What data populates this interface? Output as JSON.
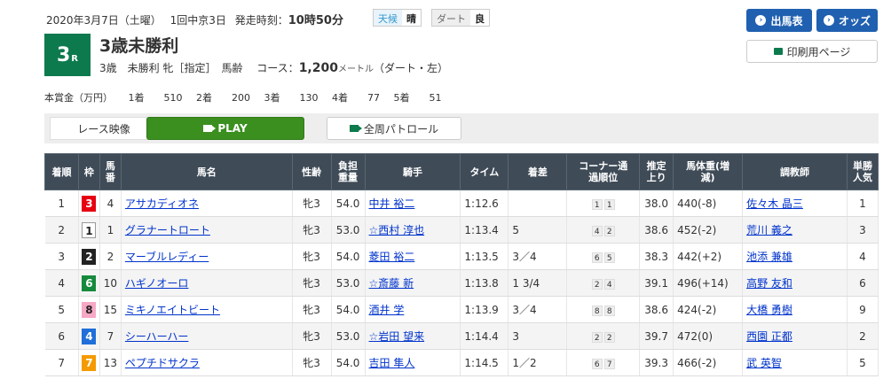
{
  "header": {
    "date": "2020年3月7日（土曜）",
    "meeting": "1回中京3日",
    "post_time_label": "発走時刻：",
    "post_time": "10時50分",
    "weather_label": "天候",
    "weather": "晴",
    "track_label": "ダート",
    "track_cond": "良"
  },
  "race": {
    "number": "3",
    "number_suffix": "R",
    "name": "3歳未勝利",
    "conditions": "3歳　未勝利 牝［指定］　馬齢　",
    "course_label": "コース：",
    "distance": "1,200",
    "distance_unit": "メートル",
    "surface": "（ダート・左）"
  },
  "buttons": {
    "entries": "出馬表",
    "odds": "オッズ",
    "print": "印刷用ページ"
  },
  "prize": {
    "label": "本賞金（万円）",
    "items": [
      {
        "place": "1着",
        "amount": "510"
      },
      {
        "place": "2着",
        "amount": "200"
      },
      {
        "place": "3着",
        "amount": "130"
      },
      {
        "place": "4着",
        "amount": "77"
      },
      {
        "place": "5着",
        "amount": "51"
      }
    ]
  },
  "video": {
    "label": "レース映像",
    "play": "PLAY",
    "patrol": "全周パトロール"
  },
  "table": {
    "headers": [
      "着順",
      "枠",
      "馬番",
      "馬名",
      "性齢",
      "負担重量",
      "騎手",
      "タイム",
      "着差",
      "コーナー通過順位",
      "推定上り",
      "馬体重(増減)",
      "調教師",
      "単勝人気"
    ],
    "rows": [
      {
        "rank": "1",
        "waku": "3",
        "num": "4",
        "horse": "アサカディオネ",
        "sex": "牝3",
        "weight": "54.0",
        "jockey": "中井 裕二",
        "time": "1:12.6",
        "margin": "",
        "c1": "1",
        "c2": "1",
        "last": "38.0",
        "bw": "440",
        "bwd": "(-8)",
        "trainer": "佐々木 晶三",
        "pop": "1"
      },
      {
        "rank": "2",
        "waku": "1",
        "num": "1",
        "horse": "グラナートロート",
        "sex": "牝3",
        "weight": "53.0",
        "jockey": "☆西村 淳也",
        "time": "1:13.4",
        "margin": "5",
        "c1": "4",
        "c2": "2",
        "last": "38.6",
        "bw": "452",
        "bwd": "(-2)",
        "trainer": "荒川 義之",
        "pop": "3"
      },
      {
        "rank": "3",
        "waku": "2",
        "num": "2",
        "horse": "マーブルレディー",
        "sex": "牝3",
        "weight": "54.0",
        "jockey": "菱田 裕二",
        "time": "1:13.5",
        "margin": "3／4",
        "c1": "6",
        "c2": "5",
        "last": "38.3",
        "bw": "442",
        "bwd": "(+2)",
        "trainer": "池添 兼雄",
        "pop": "4"
      },
      {
        "rank": "4",
        "waku": "6",
        "num": "10",
        "horse": "ハギノオーロ",
        "sex": "牝3",
        "weight": "53.0",
        "jockey": "☆斎藤 新",
        "time": "1:13.8",
        "margin": "1 3/4",
        "c1": "2",
        "c2": "4",
        "last": "39.1",
        "bw": "496",
        "bwd": "(+14)",
        "trainer": "高野 友和",
        "pop": "6"
      },
      {
        "rank": "5",
        "waku": "8",
        "num": "15",
        "horse": "ミキノエイトビート",
        "sex": "牝3",
        "weight": "54.0",
        "jockey": "酒井 学",
        "time": "1:13.9",
        "margin": "3／4",
        "c1": "8",
        "c2": "8",
        "last": "38.6",
        "bw": "424",
        "bwd": "(-2)",
        "trainer": "大橋 勇樹",
        "pop": "9"
      },
      {
        "rank": "6",
        "waku": "4",
        "num": "7",
        "horse": "シーハーハー",
        "sex": "牝3",
        "weight": "53.0",
        "jockey": "☆岩田 望来",
        "time": "1:14.4",
        "margin": "3",
        "c1": "2",
        "c2": "2",
        "last": "39.7",
        "bw": "472",
        "bwd": "(0)",
        "trainer": "西園 正都",
        "pop": "2"
      },
      {
        "rank": "7",
        "waku": "7",
        "num": "13",
        "horse": "ペプチドサクラ",
        "sex": "牝3",
        "weight": "54.0",
        "jockey": "吉田 隼人",
        "time": "1:14.5",
        "margin": "1／2",
        "c1": "6",
        "c2": "7",
        "last": "39.3",
        "bw": "466",
        "bwd": "(-2)",
        "trainer": "武 英智",
        "pop": "5"
      }
    ]
  },
  "colors": {
    "waku1": "#ffffff",
    "waku2": "#222222",
    "waku3": "#e60012",
    "waku4": "#1e6fd9",
    "waku5": "#f5d500",
    "waku6": "#168a3c",
    "waku7": "#f59a00",
    "waku8": "#f7a8c5"
  }
}
